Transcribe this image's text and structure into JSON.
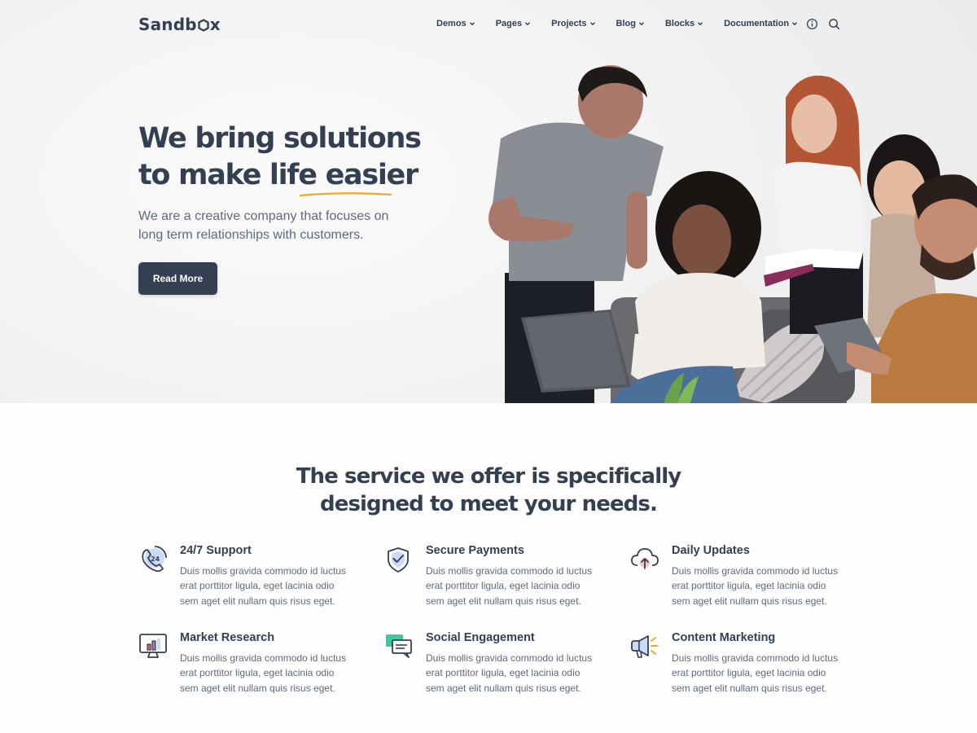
{
  "brand": {
    "name_part1": "Sandb",
    "name_part2": "x"
  },
  "nav": {
    "items": [
      {
        "label": "Demos"
      },
      {
        "label": "Pages"
      },
      {
        "label": "Projects"
      },
      {
        "label": "Blog"
      },
      {
        "label": "Blocks"
      },
      {
        "label": "Documentation"
      }
    ],
    "icons": [
      "info-icon",
      "search-icon"
    ]
  },
  "hero": {
    "title_line1": "We bring solutions",
    "title_line2_prefix": "to make life ",
    "title_line2_highlight": "easier",
    "subtitle": "We are a creative company that focuses on long term relationships with customers.",
    "button_label": "Read More",
    "accent_color": "#f5a623",
    "photo": "group-of-students-photo"
  },
  "services": {
    "title_line1": "The service we offer is specifically",
    "title_line2": "designed to meet your needs.",
    "items": [
      {
        "icon": "support-24-icon",
        "title": "24/7 Support",
        "text": "Duis mollis gravida commodo id luctus erat porttitor ligula, eget lacinia odio sem aget elit nullam quis risus eget."
      },
      {
        "icon": "shield-check-icon",
        "title": "Secure Payments",
        "text": "Duis mollis gravida commodo id luctus erat porttitor ligula, eget lacinia odio sem aget elit nullam quis risus eget."
      },
      {
        "icon": "cloud-upload-icon",
        "title": "Daily Updates",
        "text": "Duis mollis gravida commodo id luctus erat porttitor ligula, eget lacinia odio sem aget elit nullam quis risus eget."
      },
      {
        "icon": "monitor-chart-icon",
        "title": "Market Research",
        "text": "Duis mollis gravida commodo id luctus erat porttitor ligula, eget lacinia odio sem aget elit nullam quis risus eget."
      },
      {
        "icon": "chat-bubbles-icon",
        "title": "Social Engagement",
        "text": "Duis mollis gravida commodo id luctus erat porttitor ligula, eget lacinia odio sem aget elit nullam quis risus eget."
      },
      {
        "icon": "megaphone-icon",
        "title": "Content Marketing",
        "text": "Duis mollis gravida commodo id luctus erat porttitor ligula, eget lacinia odio sem aget elit nullam quis risus eget."
      }
    ]
  },
  "colors": {
    "primary_dark": "#343f52",
    "body_text": "#60697b",
    "accent_yellow": "#f5a623",
    "icon_blue": "#3f78e0",
    "icon_pink": "#e2626b",
    "icon_teal": "#45c4a0",
    "icon_purple": "#a07cc5"
  }
}
